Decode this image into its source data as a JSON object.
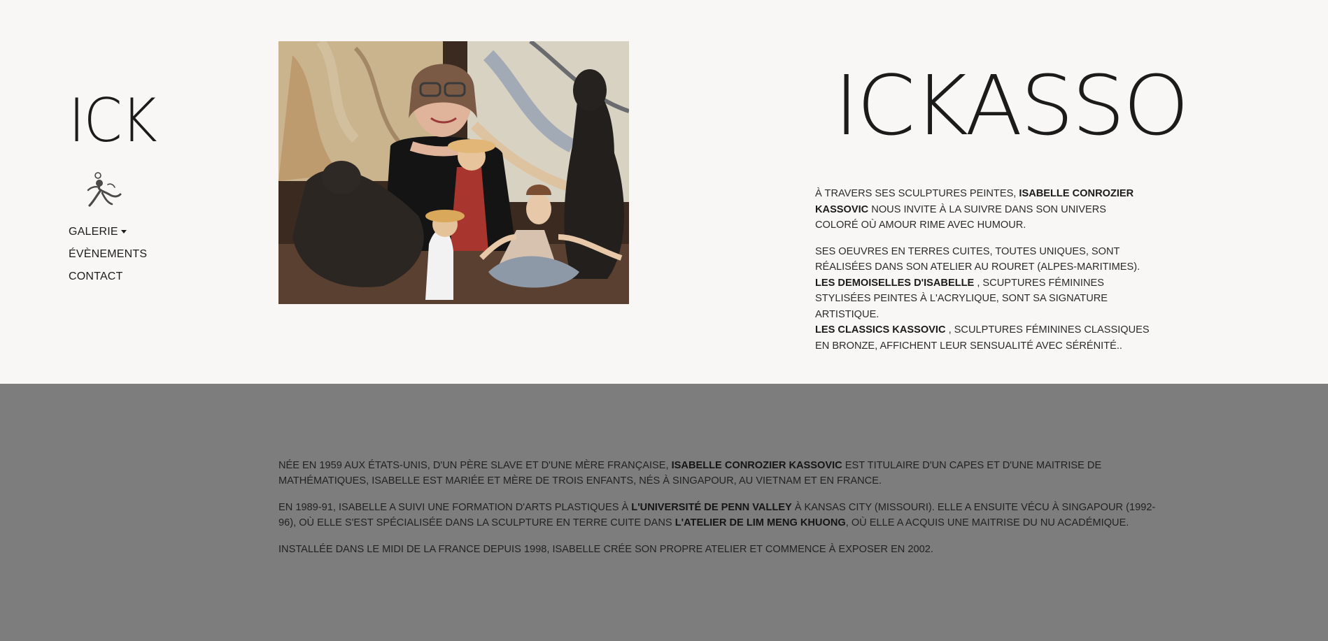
{
  "nav": {
    "logo_text": "ICK",
    "emblem_icon": "dancer-logo-icon",
    "menu": [
      {
        "label": "GALERIE",
        "has_dropdown": true
      },
      {
        "label": "ÉVÈNEMENTS"
      },
      {
        "label": "CONTACT"
      }
    ]
  },
  "hero": {
    "brand": "ICKASSO",
    "intro": {
      "p1": {
        "lead": "À TRAVERS SES SCULPTURES PEINTES, ",
        "name": "ISABELLE CONROZIER KASSOVIC",
        "rest": " NOUS INVITE À LA SUIVRE DANS SON UNIVERS COLORÉ OÙ AMOUR RIME AVEC HUMOUR."
      },
      "p2": {
        "line1": "SES OEUVRES EN TERRES CUITES, TOUTES UNIQUES, SONT RÉALISÉES DANS SON ATELIER AU ROURET (ALPES-MARITIMES).",
        "name1": "LES DEMOISELLES D'ISABELLE",
        "rest1": " , SCUPTURES FÉMININES STYLISÉES PEINTES À L'ACRYLIQUE, SONT SA SIGNATURE ARTISTIQUE.",
        "name2": "LES CLASSICS KASSOVIC",
        "rest2": " , SCULPTURES FÉMININES CLASSIQUES EN BRONZE, AFFICHENT LEUR SENSUALITÉ AVEC SÉRÉNITÉ.."
      }
    }
  },
  "bio": {
    "p1": {
      "lead": "NÉE EN 1959 AUX ÉTATS-UNIS, D'UN PÈRE SLAVE ET D'UNE MÈRE FRANÇAISE, ",
      "name": "ISABELLE CONROZIER KASSOVIC",
      "rest": " EST TITULAIRE D'UN CAPES ET D'UNE MAITRISE DE MATHÉMATIQUES, ISABELLE EST MARIÉE ET MÈRE DE TROIS ENFANTS, NÉS À SINGAPOUR, AU VIETNAM ET EN FRANCE."
    },
    "p2": {
      "lead": "EN 1989-91, ISABELLE A SUIVI UNE FORMATION D'ARTS PLASTIQUES À ",
      "school": "L'UNIVERSITÉ DE PENN VALLEY",
      "mid": " À KANSAS CITY (MISSOURI). ELLE A ENSUITE VÉCU À SINGAPOUR (1992-96), OÙ ELLE S'EST SPÉCIALISÉE DANS LA SCULPTURE EN TERRE CUITE DANS ",
      "atelier": "L'ATELIER DE LIM MENG KHUONG",
      "rest": ", OÙ ELLE A ACQUIS UNE MAITRISE DU NU ACADÉMIQUE."
    },
    "p3": "INSTALLÉE DANS LE MIDI DE LA FRANCE DEPUIS 1998, ISABELLE CRÉE SON PROPRE ATELIER ET COMMENCE À EXPOSER EN 2002."
  },
  "colors": {
    "page_bg": "#f9f7f5",
    "bio_bg": "#7d7d7d",
    "text": "#2a2a2a"
  }
}
